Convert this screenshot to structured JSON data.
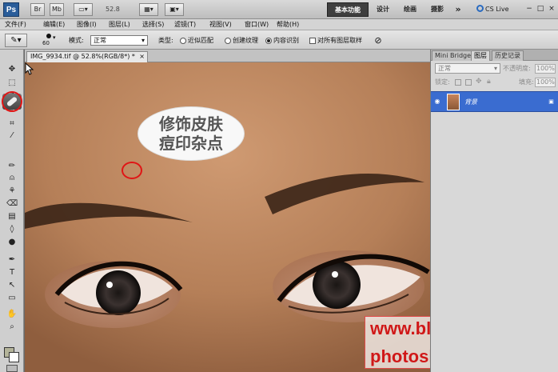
{
  "appbar": {
    "logo": "Ps",
    "mb_label": "Mb",
    "zoom": "52.8",
    "workspaces": [
      "基本功能",
      "设计",
      "绘画",
      "摄影"
    ],
    "more": "»",
    "cslive": "CS Live",
    "window_controls": [
      "−",
      "□",
      "×"
    ]
  },
  "menus": [
    "文件(F)",
    "编辑(E)",
    "图像(I)",
    "图层(L)",
    "选择(S)",
    "滤镜(T)",
    "视图(V)",
    "窗口(W)",
    "帮助(H)"
  ],
  "options": {
    "brush_size": "60",
    "mode_label": "模式:",
    "mode_value": "正常",
    "type_label": "类型:",
    "type_options": [
      "近似匹配",
      "创建纹理",
      "内容识别"
    ],
    "selected_type": 2,
    "sample_all": "对所有图层取样"
  },
  "document": {
    "tab_title": "IMG_9934.tif @ 52.8%(RGB/8*) *",
    "tab_close": "×"
  },
  "annotation": {
    "line1": "修饰皮肤",
    "line2": "痘印杂点"
  },
  "watermark": {
    "line1": "www.blwbbs.com",
    "line2": "photoshop在线培训"
  },
  "panel": {
    "tabs": [
      "Mini Bridge",
      "图层",
      "历史记录"
    ],
    "active_tab": 1,
    "blend_mode": "正常",
    "opacity_label": "不透明度:",
    "opacity_value": "100%",
    "lock_label": "锁定:",
    "fill_label": "填充:",
    "fill_value": "100%",
    "layer_name": "背景"
  },
  "colors": {
    "foreground": "#b4b49a",
    "background": "#ffffff",
    "highlight_ring": "#e01515",
    "watermark_text": "#d01818",
    "selected_layer": "#3a6cd0"
  }
}
